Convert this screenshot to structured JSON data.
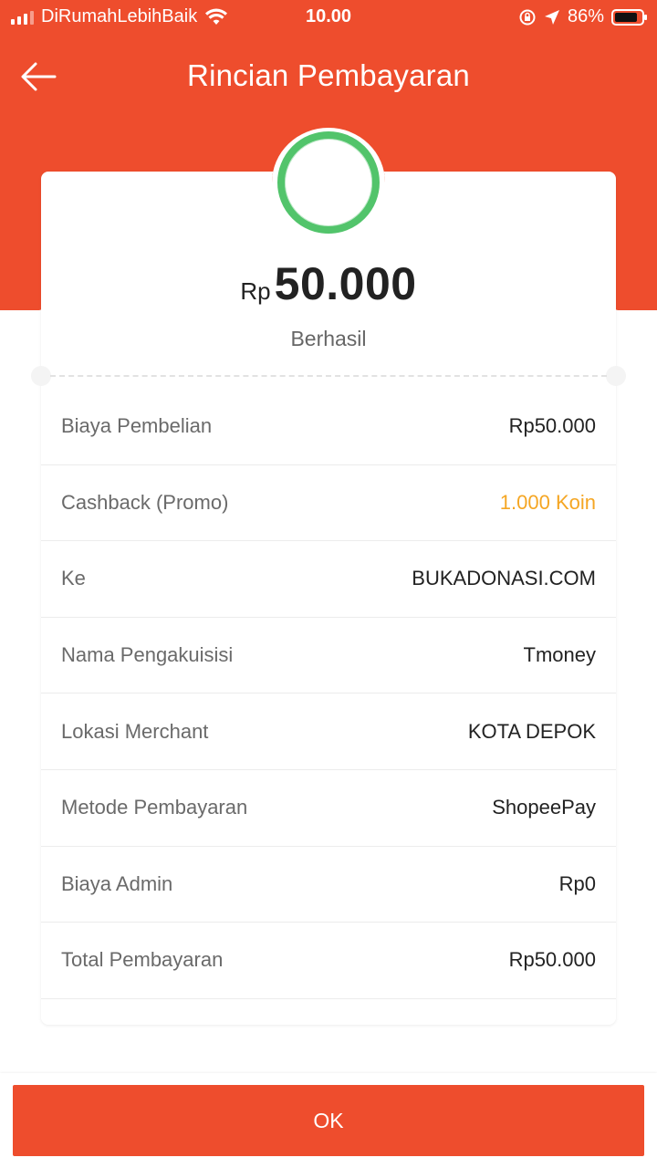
{
  "status_bar": {
    "carrier": "DiRumahLebihBaik",
    "time": "10.00",
    "battery_percent": "86%",
    "battery_level": 0.86
  },
  "header": {
    "title": "Rincian Pembayaran"
  },
  "summary": {
    "currency": "Rp",
    "amount": "50.000",
    "status": "Berhasil"
  },
  "details": [
    {
      "label": "Biaya Pembelian",
      "value": "Rp50.000"
    },
    {
      "label": "Cashback (Promo)",
      "value": "1.000 Koin"
    },
    {
      "label": "Ke",
      "value": "BUKADONASI.COM"
    },
    {
      "label": "Nama Pengakuisisi",
      "value": "Tmoney"
    },
    {
      "label": "Lokasi Merchant",
      "value": "KOTA DEPOK"
    },
    {
      "label": "Metode Pembayaran",
      "value": "ShopeePay"
    },
    {
      "label": "Biaya Admin",
      "value": "Rp0"
    },
    {
      "label": "Total Pembayaran",
      "value": "Rp50.000"
    }
  ],
  "footer": {
    "ok_label": "OK"
  },
  "colors": {
    "brand": "#ee4d2d",
    "success": "#52c46b",
    "coin": "#f5a623"
  },
  "icons": {
    "back": "arrow-left-icon",
    "wifi": "wifi-icon",
    "location": "location-arrow-icon",
    "rotation_lock": "rotation-lock-icon",
    "status": "success-circle-icon"
  }
}
